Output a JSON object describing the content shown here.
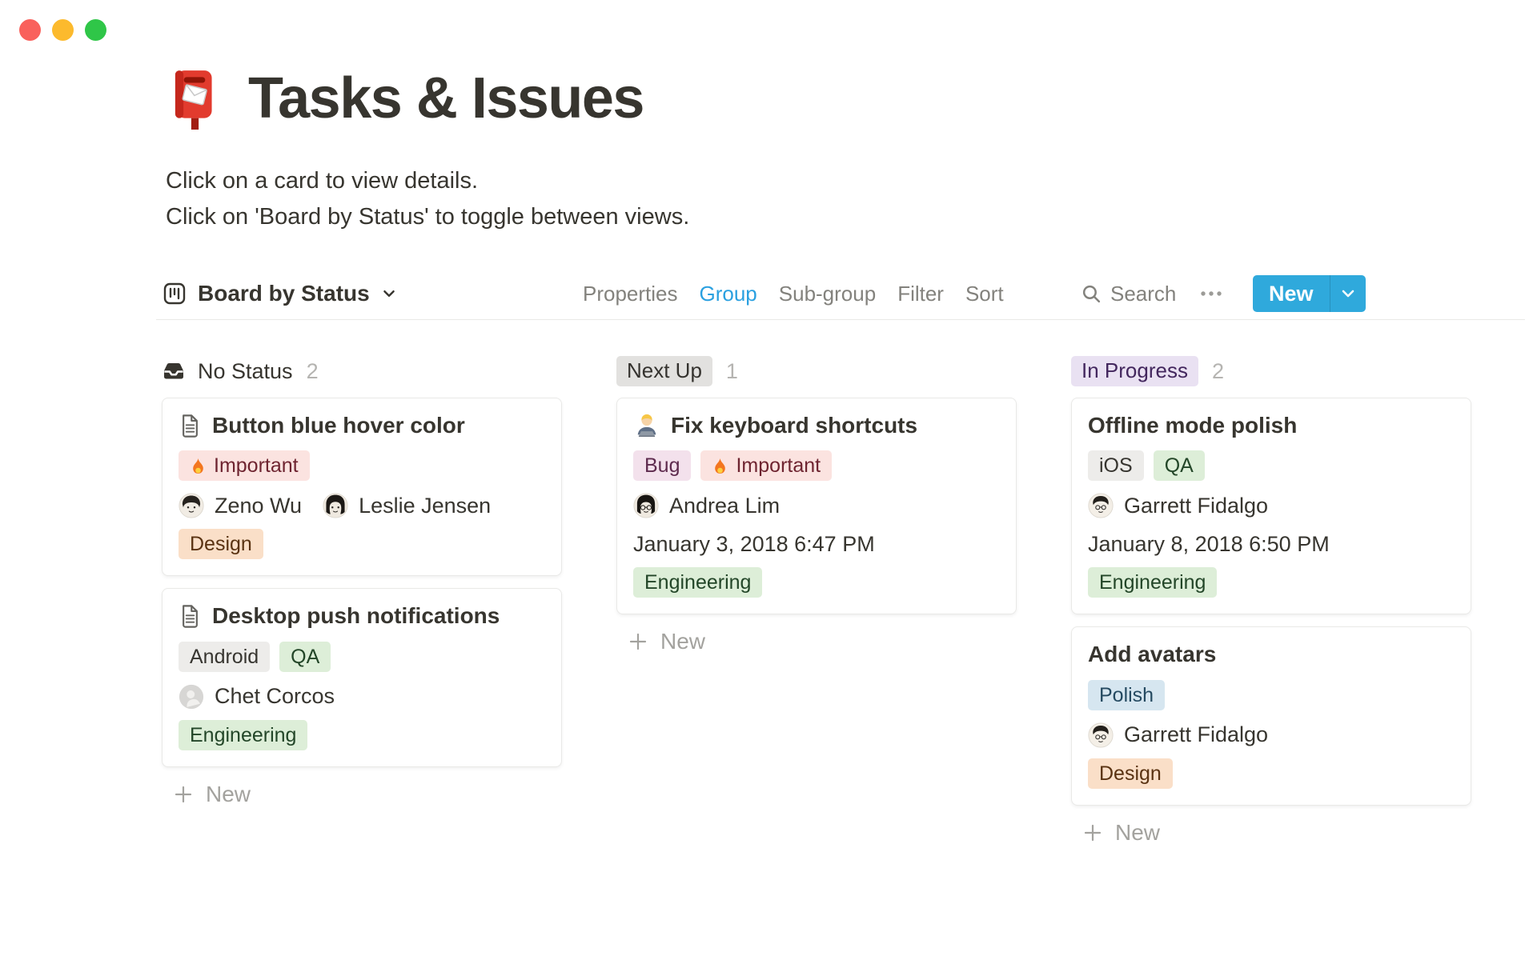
{
  "window": {
    "controls": [
      "close",
      "minimize",
      "zoom"
    ]
  },
  "page": {
    "icon": "postbox-icon",
    "title": "Tasks & Issues",
    "description": [
      "Click on a card to view details.",
      "Click on 'Board by Status' to toggle between views."
    ]
  },
  "toolbar": {
    "view": {
      "icon": "board-icon",
      "label": "Board by Status"
    },
    "menu": [
      {
        "label": "Properties",
        "active": false
      },
      {
        "label": "Group",
        "active": true
      },
      {
        "label": "Sub-group",
        "active": false
      },
      {
        "label": "Filter",
        "active": false
      },
      {
        "label": "Sort",
        "active": false
      }
    ],
    "search": {
      "icon": "search-icon",
      "label": "Search"
    },
    "more": {
      "icon": "ellipsis-icon"
    },
    "new_button": {
      "label": "New"
    }
  },
  "board": {
    "columns": [
      {
        "header": {
          "style": "plain",
          "icon": "inbox-icon",
          "label": "No Status",
          "count": "2"
        },
        "new_label": "New",
        "cards": [
          {
            "icon": "page-icon",
            "title": "Button blue hover color",
            "tags1": [
              {
                "icon": "fire-icon",
                "label": "Important",
                "color": "red"
              }
            ],
            "people": [
              {
                "name": "Zeno Wu",
                "avatar": "illustrated-man-dark-hair"
              },
              {
                "name": "Leslie Jensen",
                "avatar": "illustrated-woman-long-hair"
              }
            ],
            "tags2": [
              {
                "label": "Design",
                "color": "orange"
              }
            ]
          },
          {
            "icon": "page-icon",
            "title": "Desktop push notifications",
            "tags1": [
              {
                "label": "Android",
                "color": "gray"
              },
              {
                "label": "QA",
                "color": "green"
              }
            ],
            "people": [
              {
                "name": "Chet Corcos",
                "avatar": "default-gray-silhouette"
              }
            ],
            "tags2": [
              {
                "label": "Engineering",
                "color": "green"
              }
            ]
          }
        ]
      },
      {
        "header": {
          "style": "badge",
          "label": "Next Up",
          "badge_color": "gray",
          "count": "1"
        },
        "new_label": "New",
        "cards": [
          {
            "icon": "technologist-emoji",
            "title": "Fix keyboard shortcuts",
            "tags1": [
              {
                "label": "Bug",
                "color": "pink"
              },
              {
                "icon": "fire-icon",
                "label": "Important",
                "color": "red"
              }
            ],
            "people": [
              {
                "name": "Andrea Lim",
                "avatar": "illustrated-woman-glasses"
              }
            ],
            "date": "January 3, 2018 6:47 PM",
            "tags2": [
              {
                "label": "Engineering",
                "color": "green"
              }
            ]
          }
        ]
      },
      {
        "header": {
          "style": "badge",
          "label": "In Progress",
          "badge_color": "purple",
          "count": "2"
        },
        "new_label": "New",
        "cards": [
          {
            "title": "Offline mode polish",
            "tags1": [
              {
                "label": "iOS",
                "color": "gray"
              },
              {
                "label": "QA",
                "color": "green"
              }
            ],
            "people": [
              {
                "name": "Garrett Fidalgo",
                "avatar": "illustrated-man-glasses"
              }
            ],
            "date": "January 8, 2018 6:50 PM",
            "tags2": [
              {
                "label": "Engineering",
                "color": "green"
              }
            ]
          },
          {
            "title": "Add avatars",
            "tags1": [
              {
                "label": "Polish",
                "color": "blue"
              }
            ],
            "people": [
              {
                "name": "Garrett Fidalgo",
                "avatar": "illustrated-man-glasses"
              }
            ],
            "tags2": [
              {
                "label": "Design",
                "color": "orange"
              }
            ]
          }
        ]
      }
    ]
  },
  "colors": {
    "accent_blue": "#2fa9dc",
    "active_tab_blue": "#2aa0e0",
    "tag_red_bg": "#fbe3e0",
    "tag_red_text": "#6e2430",
    "tag_pink_bg": "#f3e1ec",
    "tag_pink_text": "#5e2b4e",
    "tag_gray_bg": "#edecea",
    "tag_gray_text": "#373530",
    "tag_green_bg": "#ddeed8",
    "tag_green_text": "#234628",
    "tag_orange_bg": "#fadfc8",
    "tag_orange_text": "#5a3312",
    "tag_blue_bg": "#d6e6f0",
    "tag_blue_text": "#254a61",
    "badge_purple_bg": "#e9e1f2",
    "badge_purple_text": "#43275e",
    "badge_gray_bg": "#e2e1df",
    "traffic_red": "#f9615c",
    "traffic_yellow": "#fcba2d",
    "traffic_green": "#2fc648"
  }
}
